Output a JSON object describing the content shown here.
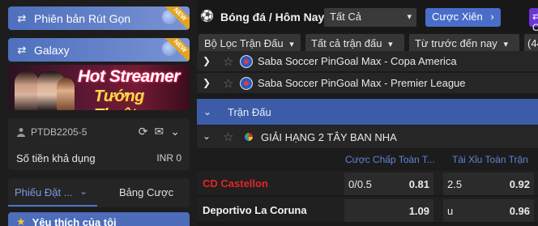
{
  "sidebar": {
    "promo1": {
      "icon": "swap-icon",
      "label": "Phiên bản Rút Gọn",
      "badge": "NEW"
    },
    "promo2": {
      "icon": "swap-icon",
      "label": "Galaxy",
      "badge": "NEW"
    },
    "banner": {
      "line1": "Hot Streamer",
      "line2": "Tướng Thuật"
    },
    "account": {
      "username": "PTDB2205-5",
      "balance_label": "Số tiền khả dụng",
      "balance_value": "INR 0"
    },
    "tabs": [
      {
        "label": "Phiếu Đặt ...",
        "active": true
      },
      {
        "label": "Bảng Cược",
        "active": false
      }
    ],
    "favorites_label": "Yêu thích của tôi"
  },
  "header": {
    "sport_title": "Bóng đá / Hôm Nay",
    "filter_all": "Tất Cả",
    "parlay_button": "Cược Xiên",
    "purple_button": "C"
  },
  "filters": {
    "league_filter": "Bộ Lọc Trận Đấu",
    "match_filter": "Tất cả trận đấu",
    "sort": "Từ trước đến nay",
    "count": "(44"
  },
  "leagues": [
    {
      "name": "Saba Soccer PinGoal Max - Copa America"
    },
    {
      "name": "Saba Soccer PinGoal Max - Premier League"
    }
  ],
  "matches_section": {
    "label": "Trận Đấu"
  },
  "competition": {
    "name": "GIẢI HẠNG 2 TÂY BAN NHA"
  },
  "columns": {
    "handicap": "Cược Chấp Toàn T...",
    "over_under": "Tài Xỉu Toàn Trận"
  },
  "rows": [
    {
      "team": "CD Castellon",
      "team_color": "#e32626",
      "hdp_line": "0/0.5",
      "hdp_price": "0.81",
      "ou_line": "2.5",
      "ou_price": "0.92"
    },
    {
      "team": "Deportivo La Coruna",
      "team_color": "#f2f2f2",
      "hdp_line": "",
      "hdp_price": "1.09",
      "ou_line": "u",
      "ou_price": "0.96"
    }
  ],
  "colors": {
    "accent_blue": "#4a6dc9",
    "purple": "#6b35d9",
    "home_team_red": "#e32626"
  }
}
